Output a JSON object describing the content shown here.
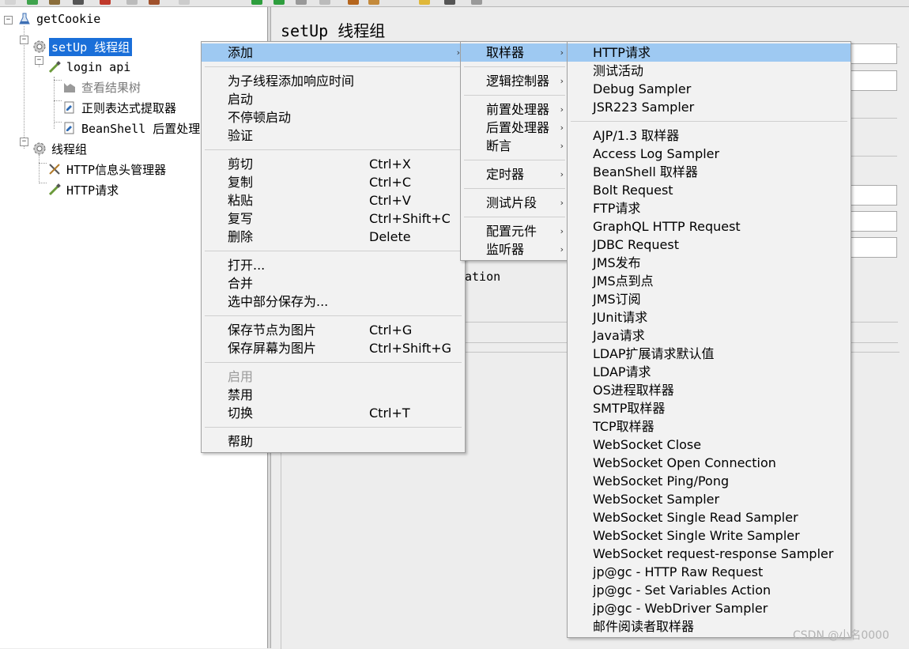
{
  "tree": {
    "nodes": [
      {
        "label": "getCookie",
        "icon": "test-plan-icon"
      },
      {
        "label": "setUp 线程组",
        "icon": "gear-icon"
      },
      {
        "label": "login api",
        "icon": "pipette-sampler-icon"
      },
      {
        "label": "查看结果树",
        "icon": "chart-listener-icon"
      },
      {
        "label": "正则表达式提取器",
        "icon": "post-processor-icon"
      },
      {
        "label": "BeanShell 后置处理",
        "icon": "post-processor-icon"
      },
      {
        "label": "线程组",
        "icon": "gear-icon"
      },
      {
        "label": "HTTP信息头管理器",
        "icon": "wrench-config-icon"
      },
      {
        "label": "HTTP请求",
        "icon": "pipette-sampler-icon"
      }
    ]
  },
  "content": {
    "title": "setUp 线程组",
    "fragment": "ation"
  },
  "context_menu": {
    "items": [
      {
        "label": "添加",
        "submenu": true
      },
      {
        "label": "为子线程添加响应时间"
      },
      {
        "label": "启动"
      },
      {
        "label": "不停顿启动"
      },
      {
        "label": "验证"
      },
      {
        "label": "剪切",
        "shortcut": "Ctrl+X"
      },
      {
        "label": "复制",
        "shortcut": "Ctrl+C"
      },
      {
        "label": "粘贴",
        "shortcut": "Ctrl+V"
      },
      {
        "label": "复写",
        "shortcut": "Ctrl+Shift+C"
      },
      {
        "label": "删除",
        "shortcut": "Delete"
      },
      {
        "label": "打开..."
      },
      {
        "label": "合并"
      },
      {
        "label": "选中部分保存为..."
      },
      {
        "label": "保存节点为图片",
        "shortcut": "Ctrl+G"
      },
      {
        "label": "保存屏幕为图片",
        "shortcut": "Ctrl+Shift+G"
      },
      {
        "label": "启用"
      },
      {
        "label": "禁用"
      },
      {
        "label": "切换",
        "shortcut": "Ctrl+T"
      },
      {
        "label": "帮助"
      }
    ]
  },
  "add_menu": {
    "items": [
      {
        "label": "取样器"
      },
      {
        "label": "逻辑控制器"
      },
      {
        "label": "前置处理器"
      },
      {
        "label": "后置处理器"
      },
      {
        "label": "断言"
      },
      {
        "label": "定时器"
      },
      {
        "label": "测试片段"
      },
      {
        "label": "配置元件"
      },
      {
        "label": "监听器"
      }
    ],
    "arrow": "›"
  },
  "sampler_menu": {
    "items": [
      "HTTP请求",
      "测试活动",
      "Debug Sampler",
      "JSR223 Sampler",
      "AJP/1.3 取样器",
      "Access Log Sampler",
      "BeanShell 取样器",
      "Bolt Request",
      "FTP请求",
      "GraphQL HTTP Request",
      "JDBC Request",
      "JMS发布",
      "JMS点到点",
      "JMS订阅",
      "JUnit请求",
      "Java请求",
      "LDAP扩展请求默认值",
      "LDAP请求",
      "OS进程取样器",
      "SMTP取样器",
      "TCP取样器",
      "WebSocket Close",
      "WebSocket Open Connection",
      "WebSocket Ping/Pong",
      "WebSocket Sampler",
      "WebSocket Single Read Sampler",
      "WebSocket Single Write Sampler",
      "WebSocket request-response Sampler",
      "jp@gc - HTTP Raw Request",
      "jp@gc - Set Variables Action",
      "jp@gc - WebDriver Sampler",
      "邮件阅读者取样器"
    ]
  },
  "tree_expander": {
    "collapse": "−"
  },
  "watermark": "CSDN @小名0000",
  "colors": {
    "selection": "#1a6fd9",
    "menu_highlight": "#9ec9f2",
    "menu_background": "#f2f2f2"
  }
}
